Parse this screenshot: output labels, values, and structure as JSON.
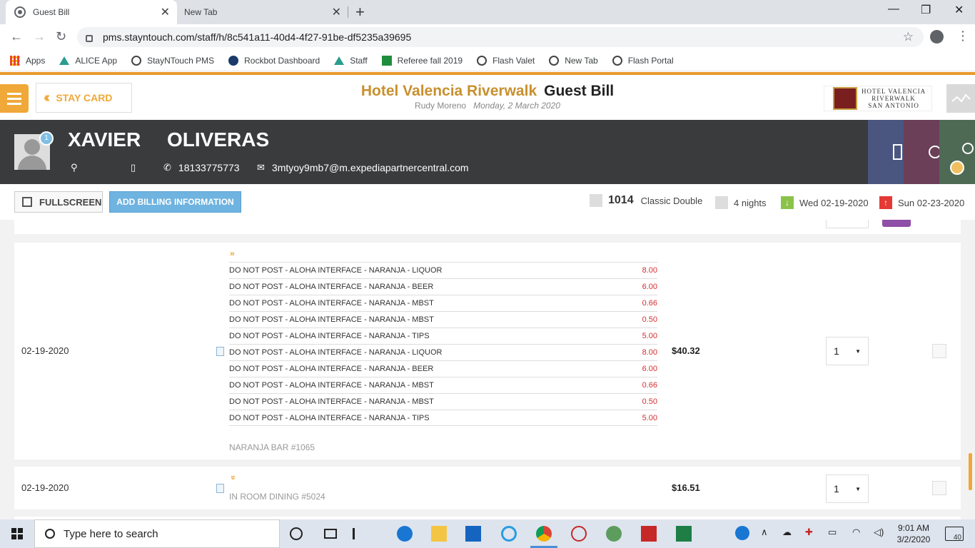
{
  "browser": {
    "tabs": [
      {
        "title": "Guest Bill",
        "close": "✕"
      },
      {
        "title": "New Tab",
        "close": "✕"
      }
    ],
    "new_tab": "+",
    "url": "pms.stayntouch.com/staff/h/8c541a11-40d4-4f27-91be-df5235a39695",
    "bookmarks": [
      "Apps",
      "ALICE App",
      "StayNTouch PMS",
      "Rockbot Dashboard",
      "Staff",
      "Referee fall 2019",
      "Flash Valet",
      "New Tab",
      "Flash Portal"
    ]
  },
  "header": {
    "back_label": "STAY CARD",
    "hotel_name": "Hotel Valencia Riverwalk",
    "page_title": "Guest Bill",
    "user": "Rudy Moreno",
    "date": "Monday, 2 March 2020",
    "logo_line1": "HOTEL VALENCIA",
    "logo_line2": "RIVERWALK",
    "logo_line3": "SAN ANTONIO"
  },
  "guest": {
    "first_name": "XAVIER",
    "last_name": "OLIVERAS",
    "badge_count": "1",
    "phone": "18133775773",
    "email": "3mtyoy9mb7@m.expediapartnercentral.com"
  },
  "toolbar": {
    "fullscreen_label": "FULLSCREEN",
    "billing_label": "ADD BILLING INFORMATION",
    "room_number": "1014",
    "room_type": "Classic Double",
    "nights": "4 nights",
    "arrival": "Wed 02-19-2020",
    "departure": "Sun 02-23-2020"
  },
  "transactions": [
    {
      "date": "02-19-2020",
      "amount": "$40.32",
      "qty": "1",
      "toggle": "»",
      "reference": "NARANJA BAR #1065",
      "items": [
        {
          "desc": "DO NOT POST - ALOHA INTERFACE - NARANJA - LIQUOR",
          "amount": "8.00"
        },
        {
          "desc": "DO NOT POST - ALOHA INTERFACE - NARANJA - BEER",
          "amount": "6.00"
        },
        {
          "desc": "DO NOT POST - ALOHA INTERFACE - NARANJA - MBST",
          "amount": "0.66"
        },
        {
          "desc": "DO NOT POST - ALOHA INTERFACE - NARANJA - MBST",
          "amount": "0.50"
        },
        {
          "desc": "DO NOT POST - ALOHA INTERFACE - NARANJA - TIPS",
          "amount": "5.00"
        },
        {
          "desc": "DO NOT POST - ALOHA INTERFACE - NARANJA - LIQUOR",
          "amount": "8.00"
        },
        {
          "desc": "DO NOT POST - ALOHA INTERFACE - NARANJA - BEER",
          "amount": "6.00"
        },
        {
          "desc": "DO NOT POST - ALOHA INTERFACE - NARANJA - MBST",
          "amount": "0.66"
        },
        {
          "desc": "DO NOT POST - ALOHA INTERFACE - NARANJA - MBST",
          "amount": "0.50"
        },
        {
          "desc": "DO NOT POST - ALOHA INTERFACE - NARANJA - TIPS",
          "amount": "5.00"
        }
      ]
    },
    {
      "date": "02-19-2020",
      "amount": "$16.51",
      "qty": "1",
      "toggle": "»",
      "reference": "IN ROOM DINING #5024"
    }
  ],
  "taskbar": {
    "search_placeholder": "Type here to search",
    "time": "9:01 AM",
    "date": "3/2/2020",
    "notifications": "40"
  },
  "colors": {
    "accent": "#f0a838",
    "guest_bar": "#3a3b3d",
    "billing_button": "#6fb3e0",
    "item_amount": "#d32f2f"
  }
}
